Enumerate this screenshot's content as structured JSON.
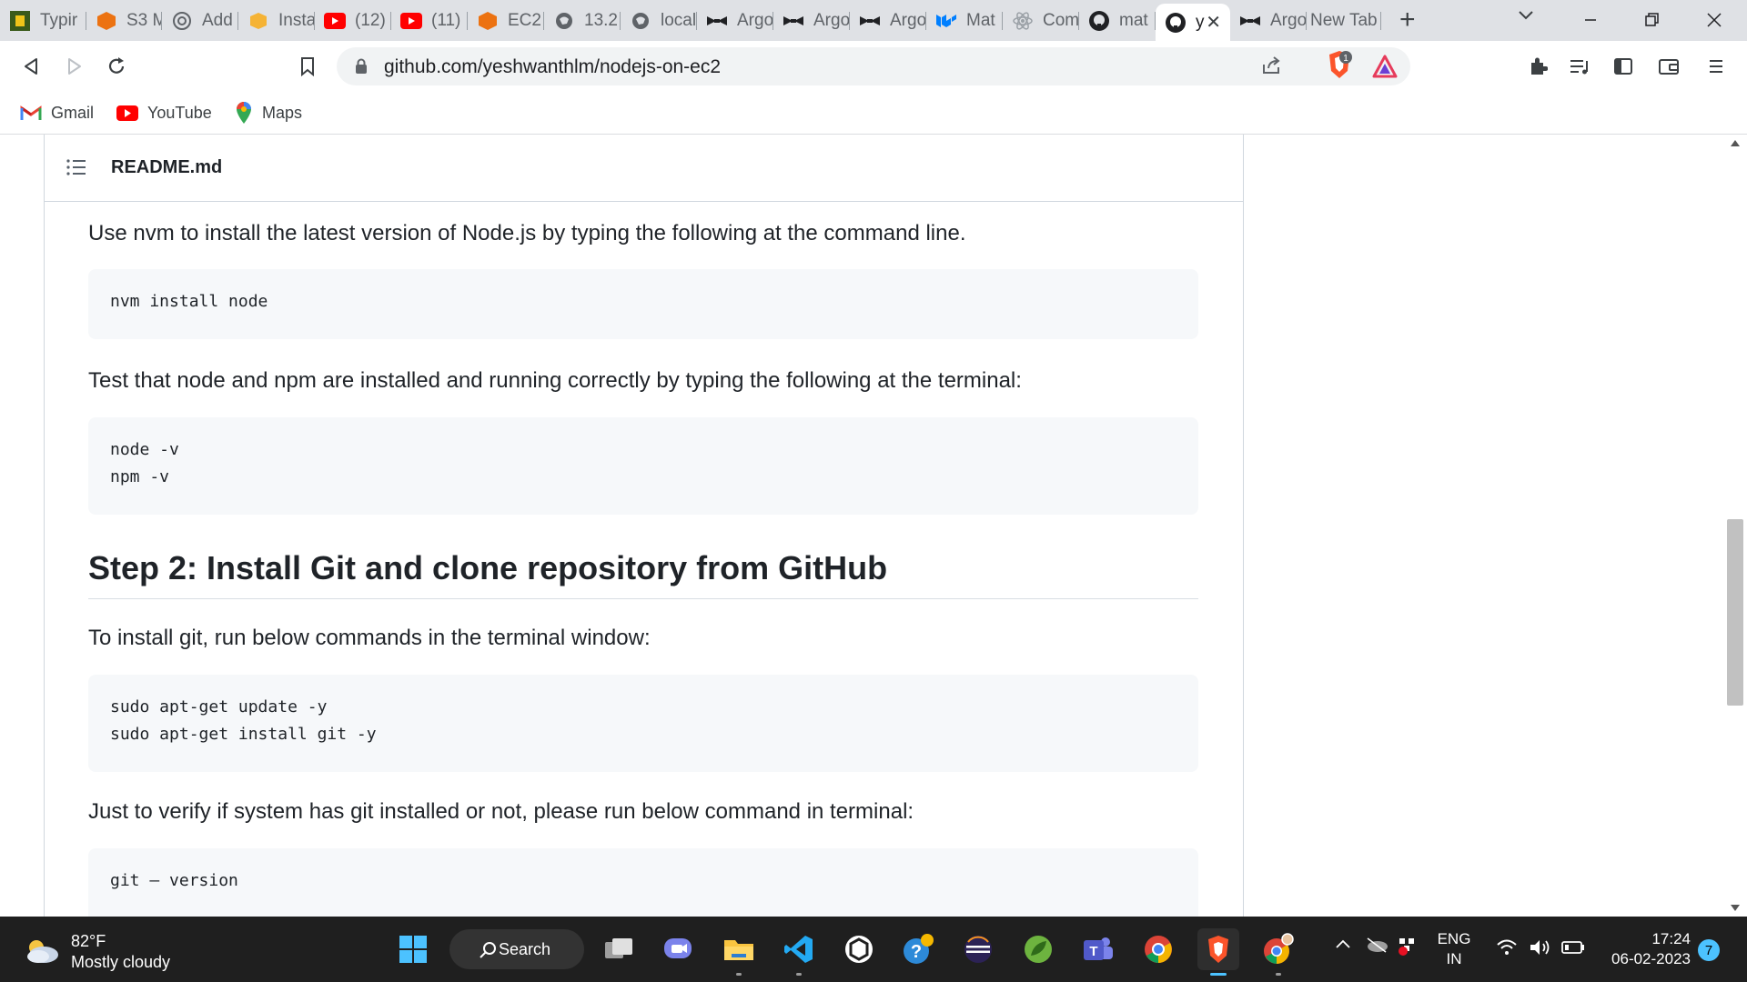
{
  "browser": {
    "tabs": [
      {
        "title": "Typir",
        "icon": "typing-icon"
      },
      {
        "title": "S3 M",
        "icon": "aws-icon"
      },
      {
        "title": "Add",
        "icon": "openai-icon"
      },
      {
        "title": "Insta",
        "icon": "aws-box-icon"
      },
      {
        "title": "(12)",
        "icon": "youtube-icon"
      },
      {
        "title": "(11)",
        "icon": "youtube-icon"
      },
      {
        "title": "EC2",
        "icon": "aws-icon"
      },
      {
        "title": "13.2",
        "icon": "globe-icon"
      },
      {
        "title": "local",
        "icon": "globe-icon"
      },
      {
        "title": "Argo",
        "icon": "argo-icon"
      },
      {
        "title": "Argo",
        "icon": "argo-icon"
      },
      {
        "title": "Argo",
        "icon": "argo-icon"
      },
      {
        "title": "Mat",
        "icon": "mui-icon"
      },
      {
        "title": "Com",
        "icon": "react-icon"
      },
      {
        "title": "mat",
        "icon": "github-icon"
      },
      {
        "title": "y",
        "icon": "github-icon",
        "active": true
      },
      {
        "title": "Argo",
        "icon": "argo-icon"
      },
      {
        "title": "New Tab",
        "icon": "none"
      }
    ],
    "url": "github.com/yeshwanthlm/nodejs-on-ec2",
    "brave_badge": "1",
    "bookmarks": [
      {
        "label": "Gmail",
        "icon": "gmail-icon"
      },
      {
        "label": "YouTube",
        "icon": "youtube-icon"
      },
      {
        "label": "Maps",
        "icon": "maps-icon"
      }
    ]
  },
  "readme": {
    "filename": "README.md",
    "p1": "Use nvm to install the latest version of Node.js by typing the following at the command line.",
    "code1": [
      "nvm install node"
    ],
    "p2": "Test that node and npm are installed and running correctly by typing the following at the terminal:",
    "code2": [
      "node -v",
      "npm -v"
    ],
    "h2": "Step 2: Install Git and clone repository from GitHub",
    "p3": "To install git, run below commands in the terminal window:",
    "code3": [
      "sudo apt-get update -y",
      "sudo apt-get install git -y"
    ],
    "p4": "Just to verify if system has git installed or not, please run below command in terminal:",
    "code4": [
      "git — version"
    ]
  },
  "taskbar": {
    "temperature": "82°F",
    "weather": "Mostly cloudy",
    "search_label": "Search",
    "lang_line1": "ENG",
    "lang_line2": "IN",
    "time": "17:24",
    "date": "06-02-2023",
    "notification_count": "7",
    "apps": [
      "windows-start-icon",
      "search",
      "task-view-icon",
      "chat-icon",
      "file-explorer-icon",
      "vscode-icon",
      "unity-icon",
      "help-icon",
      "eclipse-icon",
      "spring-icon",
      "teams-icon",
      "chrome-icon",
      "brave-icon",
      "chrome-profile-icon"
    ]
  },
  "colors": {
    "tabstrip": "#dfe1e5",
    "code_bg": "#f6f8fa",
    "taskbar": "#1f1f1f",
    "accent": "#4cc2ff"
  }
}
